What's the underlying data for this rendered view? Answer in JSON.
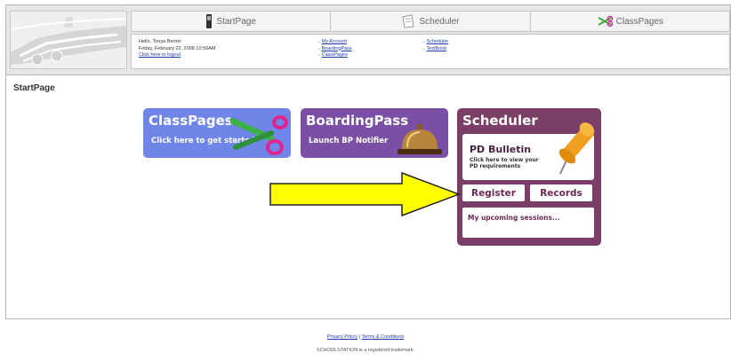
{
  "tabs": [
    {
      "label": "StartPage",
      "icon": "phone-icon"
    },
    {
      "label": "Scheduler",
      "icon": "notepad-icon"
    },
    {
      "label": "ClassPages",
      "icon": "scissors-icon"
    }
  ],
  "greeting": {
    "hello": "Hello, Tonya Berrier",
    "date": "Friday, February 22, 2008 10:56AM",
    "logout": "Click here to logout"
  },
  "links_col1": [
    "My Account",
    "BoardingPass",
    "ClassPages"
  ],
  "links_col2": [
    "Scheduler",
    "TextBook"
  ],
  "page_title": "StartPage",
  "tiles": {
    "classpages": {
      "title": "ClassPages",
      "subtitle": "Click here to get started"
    },
    "boardingpass": {
      "title": "BoardingPass",
      "subtitle": "Launch BP Notifier"
    },
    "scheduler": {
      "title": "Scheduler",
      "pd_title": "PD Bulletin",
      "pd_sub": "Click here to view your PD requirements",
      "register": "Register",
      "records": "Records",
      "upcoming": "My upcoming sessions..."
    }
  },
  "footer": {
    "privacy": "Privacy Policy",
    "separator": " | ",
    "terms": "Terms & Conditions",
    "trademark": "SCHOOLSTATION is a registered trademark."
  },
  "colors": {
    "classpages": "#6f86e8",
    "boardingpass": "#7a4fa5",
    "scheduler": "#7b3f67",
    "arrow": "#ffff00"
  }
}
